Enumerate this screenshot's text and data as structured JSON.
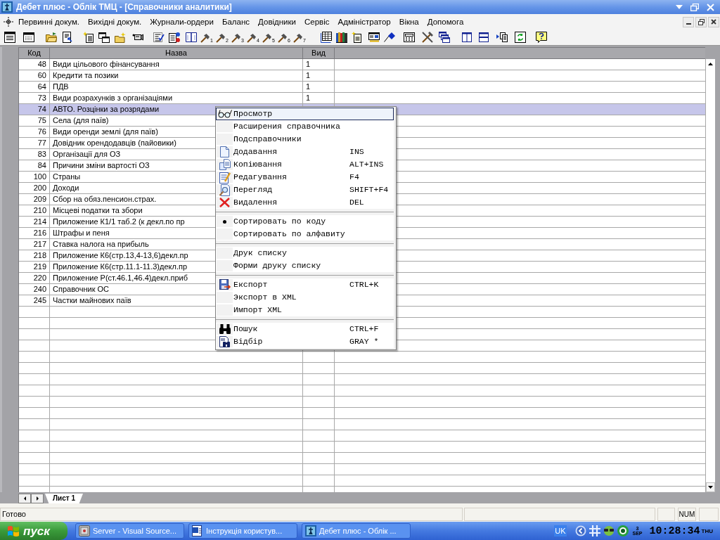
{
  "window": {
    "title": "Дебет плюс - Облік ТМЦ - [Справочники аналитики]"
  },
  "menu_bar": {
    "items": [
      "Первинні докум.",
      "Вихідні докум.",
      "Журнали-ордери",
      "Баланс",
      "Довідники",
      "Сервіс",
      "Адміністратор",
      "Вікна",
      "Допомога"
    ]
  },
  "toolbar": {
    "numbered_tools": [
      "1",
      "2",
      "3",
      "4",
      "5",
      "6",
      "7"
    ]
  },
  "table": {
    "columns": [
      "Код",
      "Назва",
      "Вид"
    ],
    "rows": [
      {
        "code": "48",
        "name": "Види цільового фінансування",
        "type": "1",
        "selected": false
      },
      {
        "code": "60",
        "name": "Кредити та позики",
        "type": "1",
        "selected": false
      },
      {
        "code": "64",
        "name": "ПДВ",
        "type": "1",
        "selected": false
      },
      {
        "code": "73",
        "name": "Види розрахунків з організаціями",
        "type": "1",
        "selected": false
      },
      {
        "code": "74",
        "name": "АВТО. Розцінки за розрядами",
        "selected": true
      },
      {
        "code": "75",
        "name": "Села (для паїв)",
        "selected": false
      },
      {
        "code": "76",
        "name": "Види оренди землі (для паїв)",
        "selected": false
      },
      {
        "code": "77",
        "name": "Довідник орендодавців (пайовики)",
        "selected": false
      },
      {
        "code": "83",
        "name": "Організації для ОЗ",
        "selected": false
      },
      {
        "code": "84",
        "name": "Причини зміни вартості ОЗ",
        "selected": false
      },
      {
        "code": "100",
        "name": "Страны",
        "selected": false
      },
      {
        "code": "200",
        "name": "Доходи",
        "selected": false
      },
      {
        "code": "209",
        "name": "Сбор на обяз.пенсион.страх.",
        "selected": false
      },
      {
        "code": "210",
        "name": "Місцеві податки та збори",
        "selected": false
      },
      {
        "code": "214",
        "name": "Приложение К1/1 таб.2 (к декл.по пр",
        "selected": false
      },
      {
        "code": "216",
        "name": "Штрафы и пеня",
        "selected": false
      },
      {
        "code": "217",
        "name": "Ставка налога на прибыль",
        "selected": false
      },
      {
        "code": "218",
        "name": "Приложение К6(стр.13,4-13,6)декл.пр",
        "selected": false
      },
      {
        "code": "219",
        "name": "Приложение К6(стр.11.1-11.3)декл.пр",
        "selected": false
      },
      {
        "code": "220",
        "name": "Приложение Р(ст.46.1,46.4)декл.приб",
        "selected": false
      },
      {
        "code": "240",
        "name": "Справочник ОС",
        "selected": false
      },
      {
        "code": "245",
        "name": "Частки майнових паїв",
        "selected": false
      }
    ]
  },
  "context_menu": {
    "groups": [
      {
        "items": [
          {
            "label": "Просмотр",
            "selected": true
          },
          {
            "label": "Расширения справочника",
            "selected": false
          },
          {
            "label": "Подсправочники",
            "selected": false
          },
          {
            "label": "Додавання",
            "shortcut": "INS",
            "selected": false
          },
          {
            "label": "Копіювання",
            "shortcut": "ALT+INS",
            "selected": false
          },
          {
            "label": "Редагування",
            "shortcut": "F4",
            "selected": false
          },
          {
            "label": "Перегляд",
            "shortcut": "SHIFT+F4",
            "selected": false
          },
          {
            "label": "Видалення",
            "shortcut": "DEL",
            "selected": false
          }
        ]
      },
      {
        "items": [
          {
            "label": "Сортировать по коду",
            "checked": true,
            "selected": false
          },
          {
            "label": "Сортировать по алфавиту",
            "checked": false,
            "selected": false
          }
        ]
      },
      {
        "items": [
          {
            "label": "Друк списку",
            "selected": false
          },
          {
            "label": "Форми друку списку",
            "selected": false
          }
        ]
      },
      {
        "items": [
          {
            "label": "Експорт",
            "shortcut": "CTRL+K",
            "selected": false
          },
          {
            "label": "Экспорт в XML",
            "selected": false
          },
          {
            "label": "Импорт XML",
            "selected": false
          }
        ]
      },
      {
        "items": [
          {
            "label": "Пошук",
            "shortcut": "CTRL+F",
            "selected": false
          },
          {
            "label": "Відбір",
            "shortcut": "GRAY *",
            "selected": false
          }
        ]
      }
    ]
  },
  "sheet_tabs": [
    {
      "label": "Лист 1",
      "selected": true
    }
  ],
  "status_bar": {
    "message": "Готово",
    "indicator": "NUM"
  },
  "taskbar": {
    "start": "пуск",
    "tasks": [
      "Server - Visual Source...",
      "Інструкція користув...",
      "Дебет плюс - Облік ..."
    ],
    "language": "UK",
    "date": {
      "day": "3",
      "month": "SEP"
    },
    "time": "10:28:34",
    "weekday": "THU"
  }
}
